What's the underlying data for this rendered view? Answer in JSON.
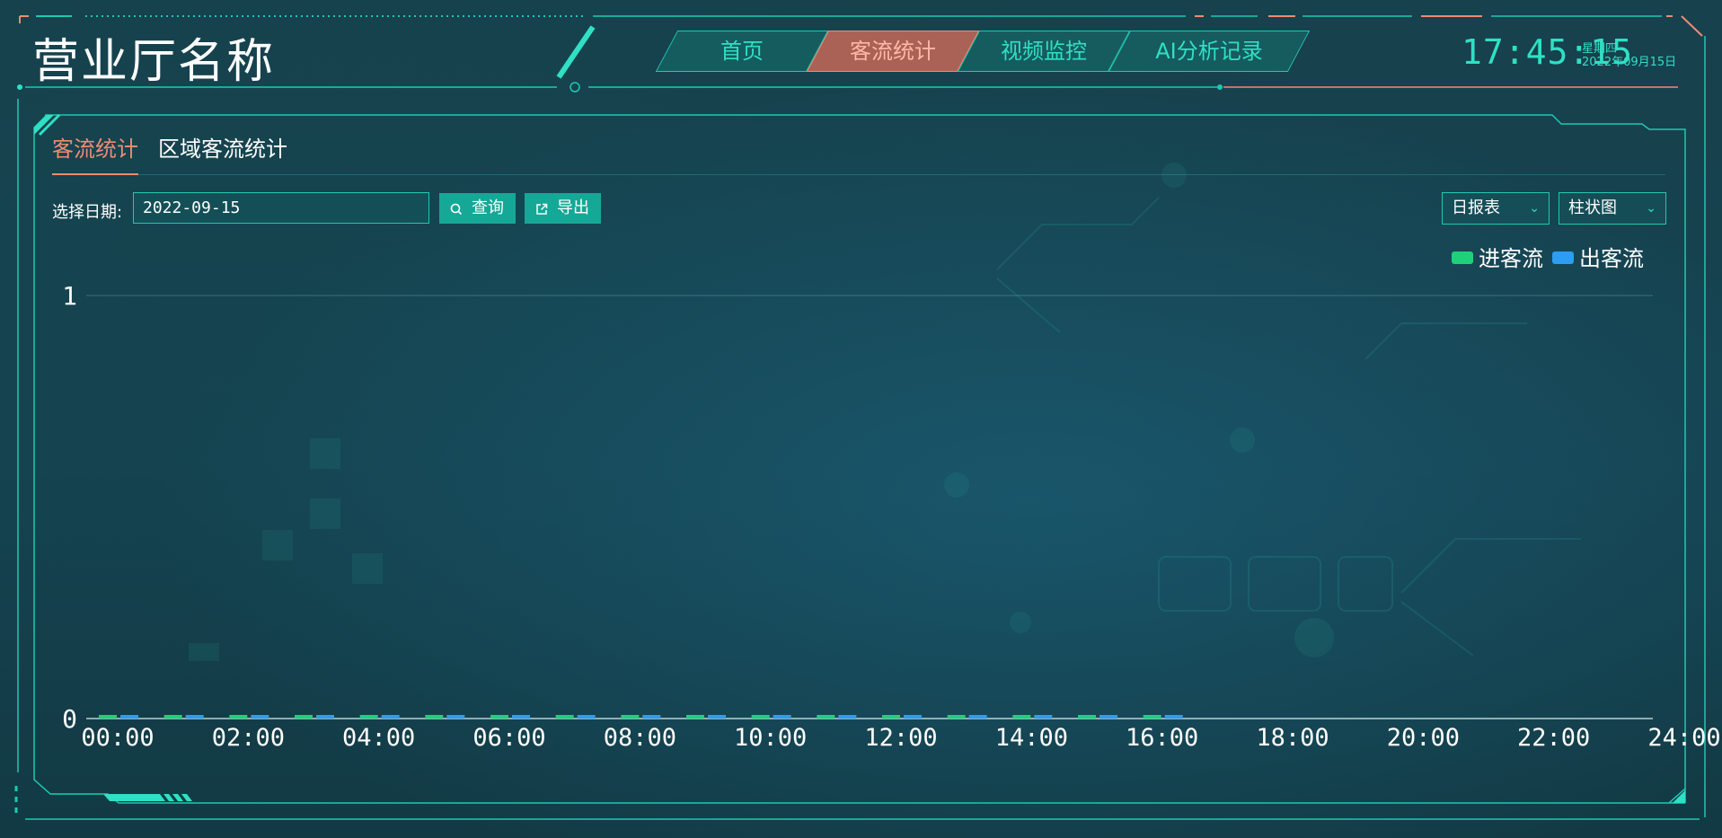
{
  "header": {
    "title": "营业厅名称",
    "nav": [
      {
        "label": "首页",
        "active": false
      },
      {
        "label": "客流统计",
        "active": true
      },
      {
        "label": "视频监控",
        "active": false
      },
      {
        "label": "AI分析记录",
        "active": false
      }
    ],
    "clock": {
      "time": "17:45:15",
      "weekday": "星期四",
      "date": "2022年09月15日"
    }
  },
  "panel": {
    "tabs": [
      {
        "label": "客流统计",
        "active": true
      },
      {
        "label": "区域客流统计",
        "active": false
      }
    ],
    "filters": {
      "date_label": "选择日期:",
      "date_value": "2022-09-15",
      "query_label": "查询",
      "export_label": "导出",
      "report_select": "日报表",
      "chart_select": "柱状图"
    }
  },
  "colors": {
    "accent": "#2fe0c4",
    "active": "#ef8b74",
    "in_flow": "#1fd07a",
    "out_flow": "#2c9df0"
  },
  "icons": {
    "query": "search-icon",
    "export": "export-icon",
    "select": "chevron-down-icon"
  },
  "chart_data": {
    "type": "bar",
    "categories": [
      "00:00",
      "01:00",
      "02:00",
      "03:00",
      "04:00",
      "05:00",
      "06:00",
      "07:00",
      "08:00",
      "09:00",
      "10:00",
      "11:00",
      "12:00",
      "13:00",
      "14:00",
      "15:00",
      "16:00"
    ],
    "series": [
      {
        "name": "进客流",
        "values": [
          0,
          0,
          0,
          0,
          0,
          0,
          0,
          0,
          0,
          0,
          0,
          0,
          0,
          0,
          0,
          0,
          0
        ]
      },
      {
        "name": "出客流",
        "values": [
          0,
          0,
          0,
          0,
          0,
          0,
          0,
          0,
          0,
          0,
          0,
          0,
          0,
          0,
          0,
          0,
          0
        ]
      }
    ],
    "x_tick_labels": [
      "00:00",
      "02:00",
      "04:00",
      "06:00",
      "08:00",
      "10:00",
      "12:00",
      "14:00",
      "16:00",
      "18:00",
      "20:00",
      "22:00",
      "24:00"
    ],
    "x_range_hours": [
      0,
      24
    ],
    "y_ticks": [
      "0",
      "1"
    ],
    "ylim": [
      0,
      1
    ],
    "grid": true,
    "legend_position": "top-right",
    "title": "",
    "xlabel": "",
    "ylabel": ""
  }
}
